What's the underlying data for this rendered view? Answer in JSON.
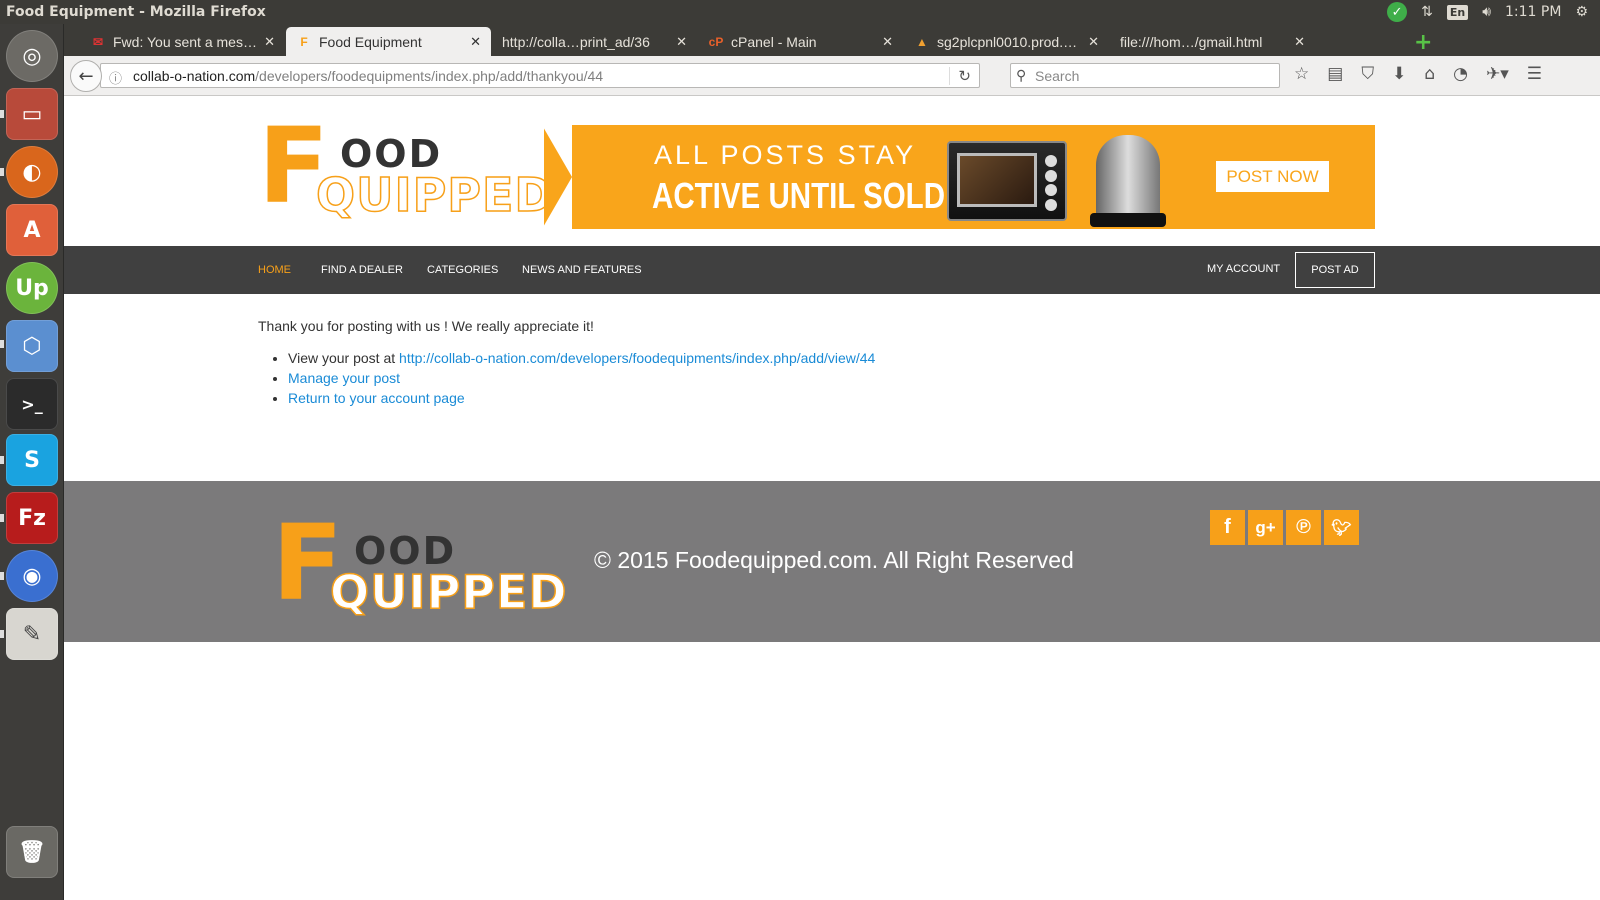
{
  "system": {
    "window_title": "Food Equipment - Mozilla Firefox",
    "lang": "En",
    "time": "1:11 PM"
  },
  "tabs": [
    {
      "title": "Fwd: You sent a mes…"
    },
    {
      "title": "Food Equipment"
    },
    {
      "title": "http://colla…print_ad/36"
    },
    {
      "title": "cPanel - Main"
    },
    {
      "title": "sg2plcpnl0010.prod.…"
    },
    {
      "title": "file:///hom…/gmail.html"
    }
  ],
  "address": {
    "domain": "collab-o-nation.com",
    "path": "/developers/foodequipments/index.php/add/thankyou/44"
  },
  "search": {
    "placeholder": "Search"
  },
  "header": {
    "logo_big": "F",
    "logo_top": "OOD",
    "logo_bottom": "QUIPPED",
    "banner_line1": "ALL POSTS STAY",
    "banner_line2": "ACTIVE UNTIL SOLD",
    "banner_button": "POST NOW"
  },
  "nav": {
    "home": "HOME",
    "find_dealer": "FIND A DEALER",
    "categories": "CATEGORIES",
    "news": "NEWS AND FEATURES",
    "my_account": "MY ACCOUNT",
    "post_ad": "POST AD"
  },
  "content": {
    "thanks": "Thank you for posting with us ! We really appreciate it!",
    "view_prefix": "View your post at ",
    "view_link": "http://collab-o-nation.com/developers/foodequipments/index.php/add/view/44",
    "manage": "Manage your post",
    "return": "Return to your account page"
  },
  "footer": {
    "copyright": "© 2015 Foodequipped.com. All Right Reserved",
    "social": [
      "f",
      "g+",
      "p",
      "t"
    ]
  },
  "colors": {
    "accent": "#f7a019",
    "nav_bg": "#404040",
    "footer_bg": "#7b7a7b",
    "link": "#1a8bd6"
  }
}
